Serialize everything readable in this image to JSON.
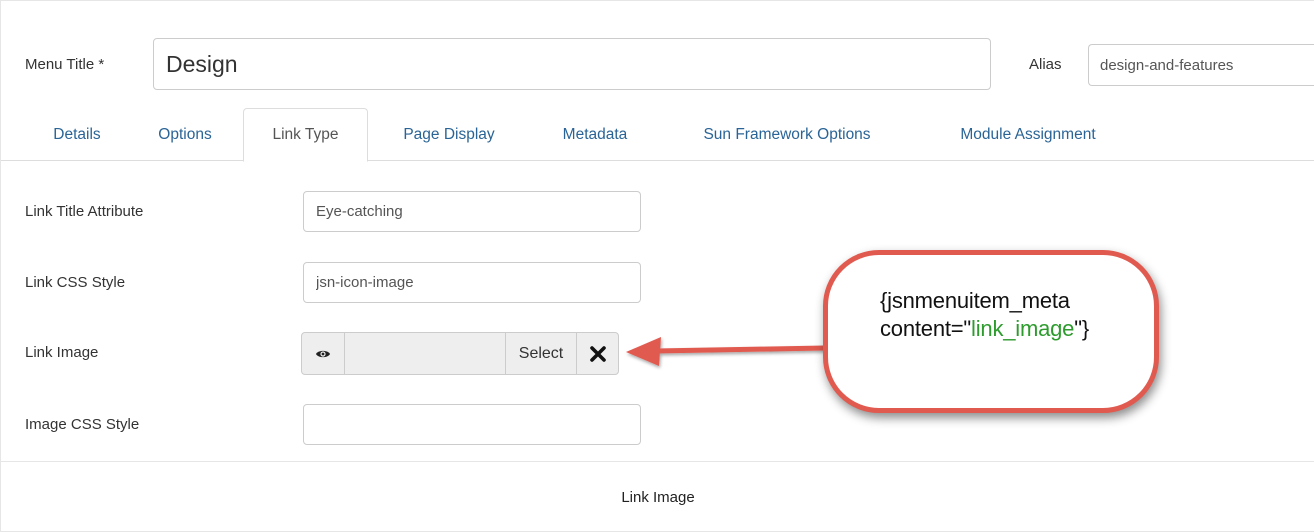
{
  "header": {
    "menu_title_label": "Menu Title *",
    "menu_title_value": "Design",
    "alias_label": "Alias",
    "alias_value": "design-and-features"
  },
  "tabs": [
    {
      "label": "Details",
      "active": false
    },
    {
      "label": "Options",
      "active": false
    },
    {
      "label": "Link Type",
      "active": true
    },
    {
      "label": "Page Display",
      "active": false
    },
    {
      "label": "Metadata",
      "active": false
    },
    {
      "label": "Sun Framework Options",
      "active": false
    },
    {
      "label": "Module Assignment",
      "active": false
    }
  ],
  "form": {
    "link_title_attribute": {
      "label": "Link Title Attribute",
      "value": "Eye-catching"
    },
    "link_css_style": {
      "label": "Link CSS Style",
      "value": "jsn-icon-image"
    },
    "link_image": {
      "label": "Link Image",
      "select_label": "Select",
      "preview_icon": "eye-icon",
      "clear_icon": "close-icon"
    },
    "image_css_style": {
      "label": "Image CSS Style",
      "value": ""
    }
  },
  "callout": {
    "line1": "{jsnmenuitem_meta",
    "line2_prefix": "content=\"",
    "line2_value": "link_image",
    "line2_suffix": "\"}",
    "border_color": "#e15a4f",
    "value_color": "#2d9b2d"
  },
  "colors": {
    "tab_link": "#2a6496",
    "arrow": "#e15a4f"
  },
  "caption": "Link Image"
}
